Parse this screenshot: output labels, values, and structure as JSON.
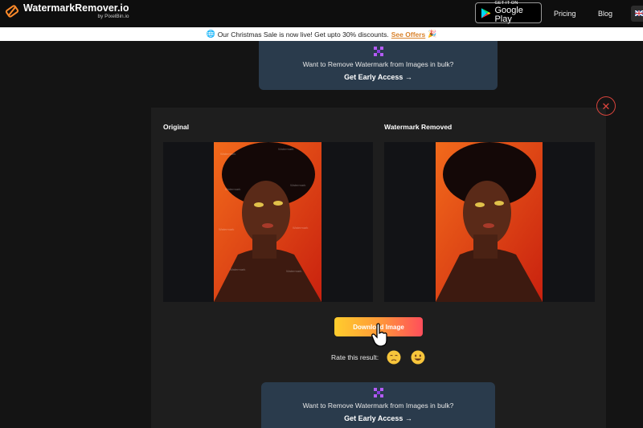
{
  "header": {
    "logo_title": "WatermarkRemover.io",
    "logo_sub": "by PixelBin.io",
    "gplay_small": "GET IT ON",
    "gplay_big": "Google Play",
    "nav": [
      "Pricing",
      "Blog"
    ]
  },
  "banner": {
    "text": "Our Christmas Sale is now live! Get upto 30% discounts.",
    "link": "See Offers"
  },
  "early_access": {
    "text": "Want to Remove Watermark from Images in bulk?",
    "link": "Get Early Access →"
  },
  "result": {
    "original_label": "Original",
    "removed_label": "Watermark Removed",
    "download_label": "Download Image",
    "rate_label": "Rate this result:",
    "close_glyph": "✕"
  },
  "colors": {
    "accent_orange": "#d9822b",
    "card_bg": "#2a3b4c",
    "close_red": "#e0463e"
  }
}
